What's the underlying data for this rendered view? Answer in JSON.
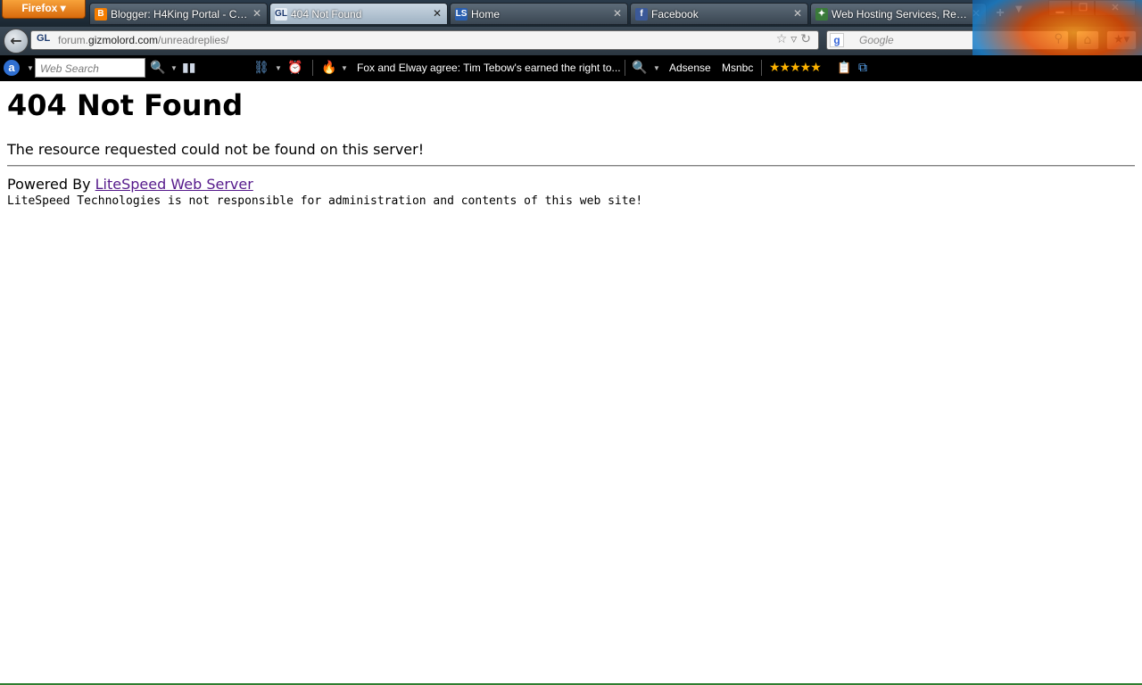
{
  "browser": {
    "menu_button": "Firefox",
    "tabs": [
      {
        "title": "Blogger: H4King Portal - Cre...",
        "favicon": "blogger-icon",
        "active": false
      },
      {
        "title": "404 Not Found",
        "favicon": "gizmolord-icon",
        "active": true
      },
      {
        "title": "Home",
        "favicon": "ls-icon",
        "active": false
      },
      {
        "title": "Facebook",
        "favicon": "facebook-icon",
        "active": false
      },
      {
        "title": "Web Hosting Services, Resel...",
        "favicon": "hosting-icon",
        "active": false
      }
    ],
    "new_tab": "+",
    "address": {
      "prefix": "forum.",
      "domain": "gizmolord.com",
      "path": "/unreadreplies/"
    },
    "search_placeholder": "Google"
  },
  "toolbar": {
    "web_search_placeholder": "Web Search",
    "headline": "Fox and Elway agree: Tim Tebow's earned the right to...",
    "link_adsense": "Adsense",
    "link_msnbc": "Msnbc",
    "rating_stars": "★★★★★"
  },
  "page": {
    "heading": "404 Not Found",
    "message": "The resource requested could not be found on this server!",
    "powered_prefix": "Powered By ",
    "powered_link": "LiteSpeed Web Server",
    "disclaimer": "LiteSpeed Technologies is not responsible for administration and contents of this web site!"
  },
  "colors": {
    "link_visited": "#551a8b",
    "firefox_button": "#e8841a",
    "toolbar_bg": "#000000"
  }
}
